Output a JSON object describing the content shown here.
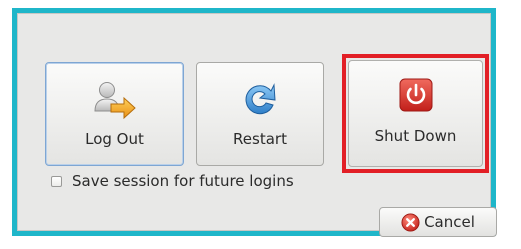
{
  "dialog": {
    "actions": {
      "logout": {
        "label": "Log Out",
        "icon": "user-logout-icon"
      },
      "restart": {
        "label": "Restart",
        "icon": "restart-icon"
      },
      "shutdown": {
        "label": "Shut Down",
        "icon": "power-icon"
      }
    },
    "save_session": {
      "label": "Save session for future logins",
      "checked": false
    },
    "cancel": {
      "label": "Cancel",
      "icon": "cancel-icon"
    }
  },
  "colors": {
    "dialog_border": "#1fb6c9",
    "highlight": "#e21f26",
    "power_button": "#d9302c",
    "restart_arrow": "#3a8fd6",
    "logout_arrow": "#f0a92e"
  }
}
